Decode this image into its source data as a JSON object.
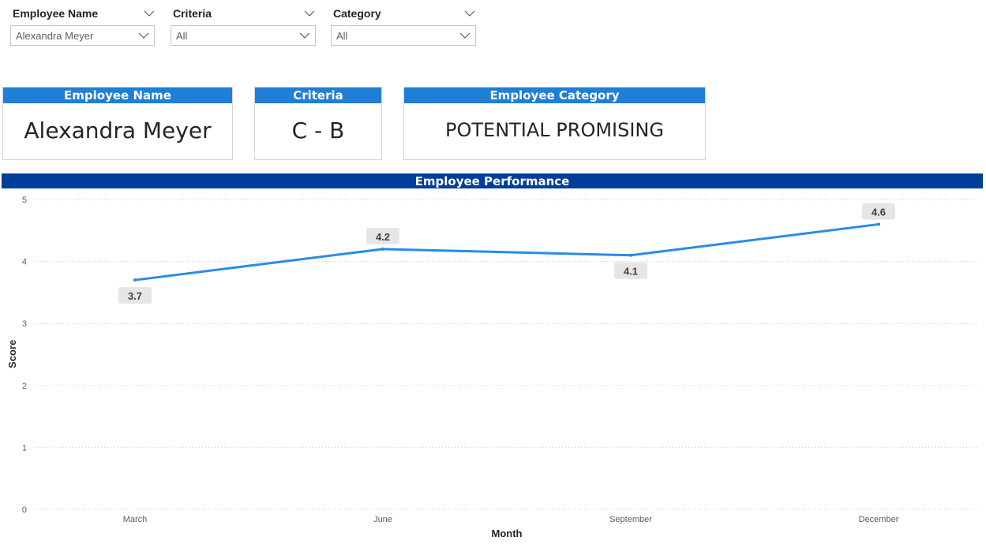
{
  "slicers": [
    {
      "title": "Employee Name",
      "value": "Alexandra Meyer"
    },
    {
      "title": "Criteria",
      "value": "All"
    },
    {
      "title": "Category",
      "value": "All"
    }
  ],
  "cards": [
    {
      "title": "Employee Name",
      "value": "Alexandra Meyer"
    },
    {
      "title": "Criteria",
      "value": "C - B"
    },
    {
      "title": "Employee Category",
      "value": "POTENTIAL PROMISING"
    }
  ],
  "chart_data": {
    "type": "line",
    "title": "Employee Performance",
    "xlabel": "Month",
    "ylabel": "Score",
    "categories": [
      "March",
      "June",
      "September",
      "December"
    ],
    "series": [
      {
        "values": [
          3.7,
          4.2,
          4.1,
          4.6
        ],
        "data_labels": [
          "3.7",
          "4.2",
          "4.1",
          "4.6"
        ],
        "color": "#2a8be6"
      }
    ],
    "ylim": [
      0,
      5
    ],
    "yticks": [
      0,
      1,
      2,
      3,
      4,
      5
    ],
    "grid": true
  },
  "colors": {
    "card_header": "#1f7fd8",
    "chart_title_bar": "#003e99",
    "line": "#2a8be6"
  },
  "icons": {
    "dropdown": "chevron-down-icon"
  }
}
